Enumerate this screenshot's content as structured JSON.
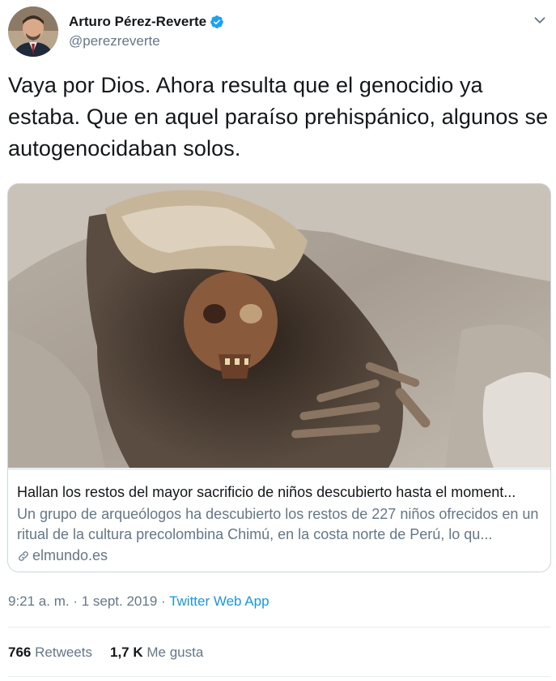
{
  "author": {
    "name": "Arturo Pérez-Reverte",
    "handle": "@perezreverte",
    "verified": true
  },
  "tweet": {
    "text": "Vaya por Dios. Ahora resulta que el genocidio ya estaba. Que en aquel paraíso prehispánico, algunos se autogenocidaban solos."
  },
  "card": {
    "image_alt": "restos arqueológicos",
    "title": "Hallan los restos del mayor sacrificio de niños descubierto hasta el moment...",
    "description": "Un grupo de arqueólogos ha descubierto los restos de 227 niños ofrecidos en un ritual de la cultura precolombina Chimú, en la costa norte de Perú, lo qu...",
    "domain": "elmundo.es"
  },
  "meta": {
    "time": "9:21 a. m. · 1 sept. 2019 · ",
    "app": "Twitter Web App"
  },
  "stats": {
    "retweets_count": "766",
    "retweets_label": "Retweets",
    "likes_count": "1,7 K",
    "likes_label": "Me gusta"
  },
  "icons": {
    "verified": "verified-badge-icon",
    "menu": "chevron-down-icon",
    "link": "link-icon"
  },
  "colors": {
    "accent": "#1b95e0",
    "text": "#14171a",
    "muted": "#657786",
    "border": "#ccd6dd"
  }
}
